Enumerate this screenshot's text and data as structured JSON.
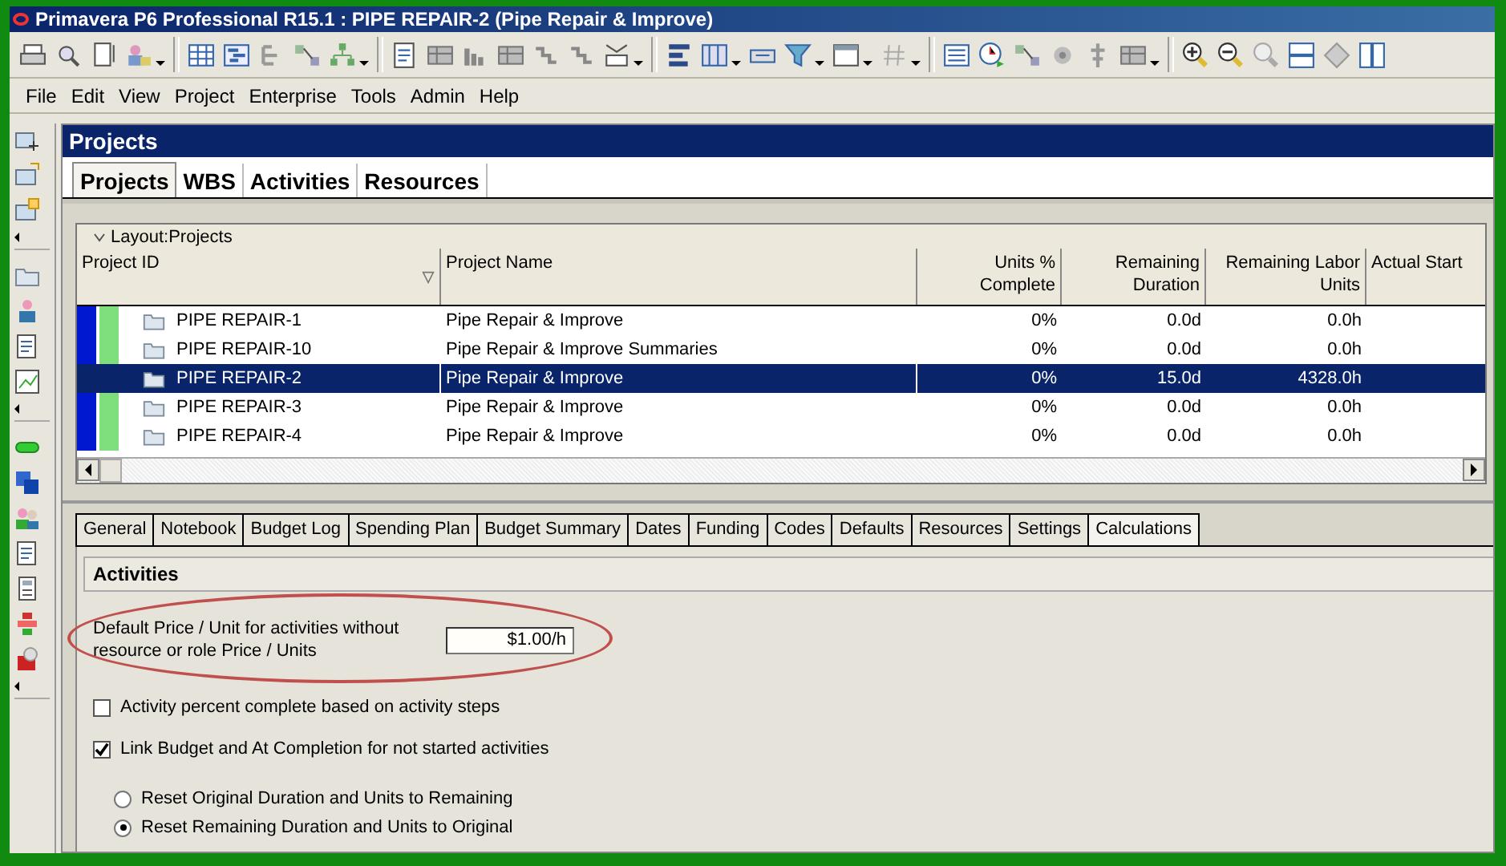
{
  "window": {
    "title": "Primavera P6 Professional R15.1 : PIPE REPAIR-2 (Pipe Repair & Improve)"
  },
  "menu": [
    "File",
    "Edit",
    "View",
    "Project",
    "Enterprise",
    "Tools",
    "Admin",
    "Help"
  ],
  "panel": {
    "title": "Projects",
    "tabs": [
      {
        "label": "Projects",
        "selected": true
      },
      {
        "label": "WBS",
        "selected": false
      },
      {
        "label": "Activities",
        "selected": false
      },
      {
        "label": "Resources",
        "selected": false
      }
    ],
    "layout_label": "Layout:Projects",
    "table": {
      "columns": [
        "Project ID",
        "Project Name",
        "Units % Complete",
        "Remaining Duration",
        "Remaining Labor Units",
        "Actual Start"
      ],
      "rows": [
        {
          "cells": [
            "PIPE REPAIR-1",
            "Pipe Repair & Improve",
            "0%",
            "0.0d",
            "0.0h"
          ],
          "selected": false
        },
        {
          "cells": [
            "PIPE REPAIR-10",
            "Pipe Repair & Improve Summaries",
            "0%",
            "0.0d",
            "0.0h"
          ],
          "selected": false
        },
        {
          "cells": [
            "PIPE REPAIR-2",
            "Pipe Repair & Improve",
            "0%",
            "15.0d",
            "4328.0h"
          ],
          "selected": true
        },
        {
          "cells": [
            "PIPE REPAIR-3",
            "Pipe Repair & Improve",
            "0%",
            "0.0d",
            "0.0h"
          ],
          "selected": false
        },
        {
          "cells": [
            "PIPE REPAIR-4",
            "Pipe Repair & Improve",
            "0%",
            "0.0d",
            "0.0h"
          ],
          "selected": false
        }
      ]
    }
  },
  "detail_tabs": [
    {
      "label": "General",
      "selected": false
    },
    {
      "label": "Notebook",
      "selected": false
    },
    {
      "label": "Budget Log",
      "selected": false
    },
    {
      "label": "Spending Plan",
      "selected": false
    },
    {
      "label": "Budget Summary",
      "selected": false
    },
    {
      "label": "Dates",
      "selected": false
    },
    {
      "label": "Funding",
      "selected": false
    },
    {
      "label": "Codes",
      "selected": false
    },
    {
      "label": "Defaults",
      "selected": false
    },
    {
      "label": "Resources",
      "selected": false
    },
    {
      "label": "Settings",
      "selected": false
    },
    {
      "label": "Calculations",
      "selected": true
    }
  ],
  "activities": {
    "title": "Activities",
    "price_field": {
      "label": "Default Price / Unit for activities without resource or role Price / Units",
      "value": "$1.00/h",
      "highlighted": true
    },
    "checkboxes": [
      {
        "label": "Activity percent complete based on activity steps",
        "checked": false
      },
      {
        "label": "Link Budget and At Completion for not started activities",
        "checked": true
      }
    ],
    "radios": [
      {
        "label": "Reset Original Duration and Units to Remaining",
        "selected": false
      },
      {
        "label": "Reset Remaining Duration and Units to Original",
        "selected": true
      }
    ]
  }
}
